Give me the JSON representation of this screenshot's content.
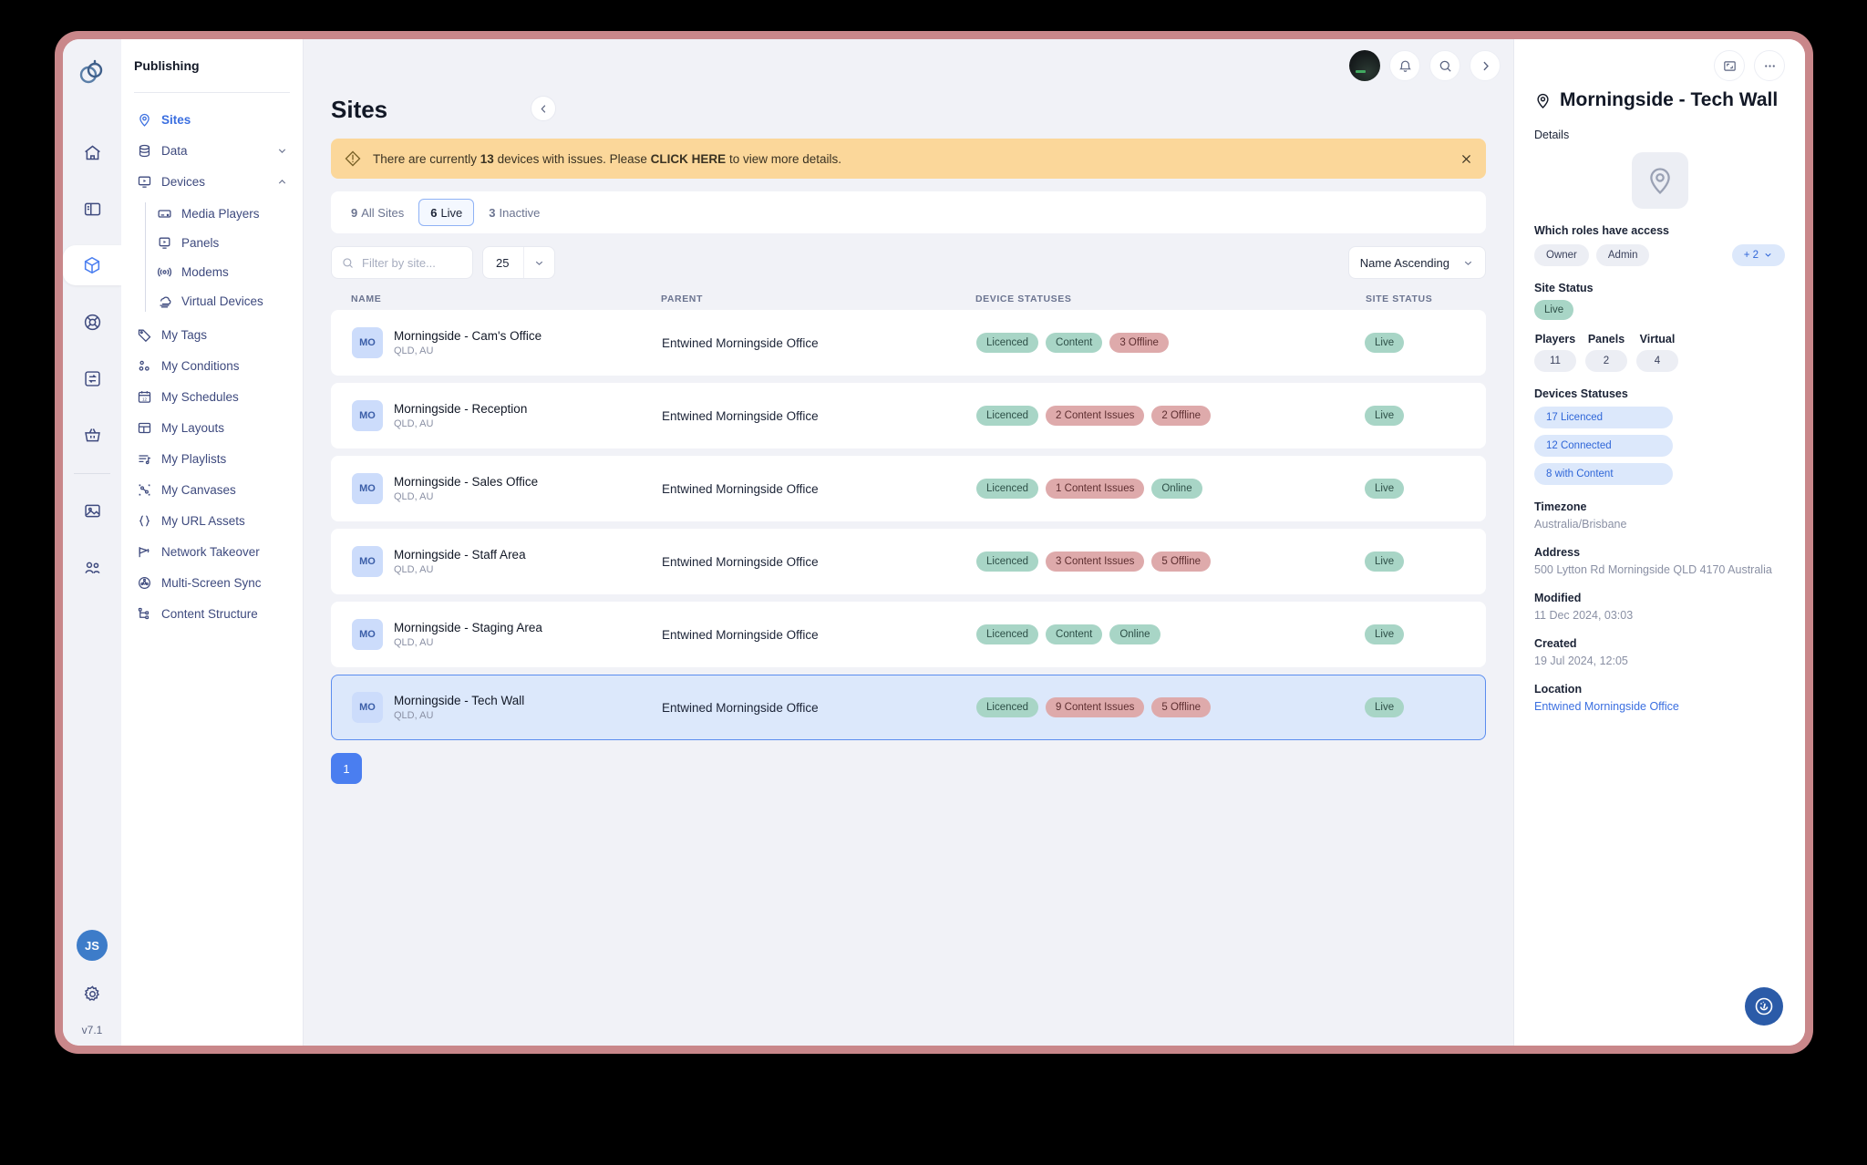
{
  "rail": {
    "logo_icon": "brand-logo-icon",
    "items": [
      {
        "name": "home",
        "icon": "home-icon",
        "active": false
      },
      {
        "name": "layouts",
        "icon": "panel-layout-icon",
        "active": false
      },
      {
        "name": "publishing",
        "icon": "package-cube-icon",
        "active": true
      },
      {
        "name": "support",
        "icon": "lifebuoy-icon",
        "active": false
      },
      {
        "name": "sync",
        "icon": "sync-exchange-icon",
        "active": false
      },
      {
        "name": "store",
        "icon": "basket-icon",
        "active": false
      },
      {
        "name": "media",
        "icon": "image-icon",
        "active": false
      },
      {
        "name": "users",
        "icon": "users-group-icon",
        "active": false
      }
    ],
    "user_initials": "JS",
    "settings_icon": "gear-icon",
    "version": "v7.1"
  },
  "nav": {
    "title": "Publishing",
    "items": [
      {
        "label": "Sites",
        "icon": "location-pin-icon",
        "active": true,
        "chevron": ""
      },
      {
        "label": "Data",
        "icon": "database-icon",
        "active": false,
        "chevron": "down"
      },
      {
        "label": "Devices",
        "icon": "device-screen-icon",
        "active": false,
        "chevron": "up"
      }
    ],
    "devices_children": [
      {
        "label": "Media Players",
        "icon": "media-player-icon"
      },
      {
        "label": "Panels",
        "icon": "panel-icon"
      },
      {
        "label": "Modems",
        "icon": "modem-signal-icon"
      },
      {
        "label": "Virtual Devices",
        "icon": "virtual-device-icon"
      }
    ],
    "items_after": [
      {
        "label": "My Tags",
        "icon": "tag-icon"
      },
      {
        "label": "My Conditions",
        "icon": "conditions-icon"
      },
      {
        "label": "My Schedules",
        "icon": "calendar-icon"
      },
      {
        "label": "My Layouts",
        "icon": "layout-grid-icon"
      },
      {
        "label": "My Playlists",
        "icon": "playlist-music-icon"
      },
      {
        "label": "My Canvases",
        "icon": "canvas-nodes-icon"
      },
      {
        "label": "My URL Assets",
        "icon": "curly-braces-icon"
      },
      {
        "label": "Network Takeover",
        "icon": "megaphone-icon"
      },
      {
        "label": "Multi-Screen Sync",
        "icon": "film-reel-icon"
      },
      {
        "label": "Content Structure",
        "icon": "tree-structure-icon"
      }
    ],
    "collapse_icon": "chevron-left-icon"
  },
  "topbar": {
    "avatar_icon": "user-avatar",
    "bell_icon": "bell-icon",
    "search_icon": "search-icon",
    "forward_icon": "chevron-right-icon",
    "expand_icon": "expand-panel-icon",
    "more_icon": "more-horizontal-icon"
  },
  "main": {
    "page_title": "Sites",
    "alert": {
      "icon": "warning-diamond-icon",
      "text_before": "There are currently ",
      "count": "13",
      "text_mid": " devices with issues. Please ",
      "link": "CLICK HERE",
      "text_after": " to view more details.",
      "close_icon": "close-icon"
    },
    "tabs": [
      {
        "count": "9",
        "label": "All Sites",
        "active": false
      },
      {
        "count": "6",
        "label": "Live",
        "active": true
      },
      {
        "count": "3",
        "label": "Inactive",
        "active": false
      }
    ],
    "search": {
      "placeholder": "Filter by site...",
      "value": "",
      "icon": "search-icon"
    },
    "page_size": {
      "value": "25",
      "caret_icon": "chevron-down-icon"
    },
    "sort": {
      "value": "Name Ascending",
      "caret_icon": "chevron-down-icon"
    },
    "columns": {
      "name": "NAME",
      "parent": "PARENT",
      "device_statuses": "DEVICE STATUSES",
      "site_status": "SITE STATUS"
    },
    "rows": [
      {
        "initials": "MO",
        "name": "Morningside - Cam's Office",
        "location": "QLD, AU",
        "parent": "Entwined Morningside Office",
        "statuses": [
          {
            "label": "Licenced",
            "tone": "green"
          },
          {
            "label": "Content",
            "tone": "green"
          },
          {
            "label": "3 Offline",
            "tone": "red"
          }
        ],
        "site_status": {
          "label": "Live",
          "tone": "green"
        },
        "selected": false
      },
      {
        "initials": "MO",
        "name": "Morningside - Reception",
        "location": "QLD, AU",
        "parent": "Entwined Morningside Office",
        "statuses": [
          {
            "label": "Licenced",
            "tone": "green"
          },
          {
            "label": "2 Content Issues",
            "tone": "red"
          },
          {
            "label": "2 Offline",
            "tone": "red"
          }
        ],
        "site_status": {
          "label": "Live",
          "tone": "green"
        },
        "selected": false
      },
      {
        "initials": "MO",
        "name": "Morningside - Sales Office",
        "location": "QLD, AU",
        "parent": "Entwined Morningside Office",
        "statuses": [
          {
            "label": "Licenced",
            "tone": "green"
          },
          {
            "label": "1 Content Issues",
            "tone": "red"
          },
          {
            "label": "Online",
            "tone": "green"
          }
        ],
        "site_status": {
          "label": "Live",
          "tone": "green"
        },
        "selected": false
      },
      {
        "initials": "MO",
        "name": "Morningside - Staff Area",
        "location": "QLD, AU",
        "parent": "Entwined Morningside Office",
        "statuses": [
          {
            "label": "Licenced",
            "tone": "green"
          },
          {
            "label": "3 Content Issues",
            "tone": "red"
          },
          {
            "label": "5 Offline",
            "tone": "red"
          }
        ],
        "site_status": {
          "label": "Live",
          "tone": "green"
        },
        "selected": false
      },
      {
        "initials": "MO",
        "name": "Morningside - Staging Area",
        "location": "QLD, AU",
        "parent": "Entwined Morningside Office",
        "statuses": [
          {
            "label": "Licenced",
            "tone": "green"
          },
          {
            "label": "Content",
            "tone": "green"
          },
          {
            "label": "Online",
            "tone": "green"
          }
        ],
        "site_status": {
          "label": "Live",
          "tone": "green"
        },
        "selected": false
      },
      {
        "initials": "MO",
        "name": "Morningside - Tech Wall",
        "location": "QLD, AU",
        "parent": "Entwined Morningside Office",
        "statuses": [
          {
            "label": "Licenced",
            "tone": "green"
          },
          {
            "label": "9 Content Issues",
            "tone": "red"
          },
          {
            "label": "5 Offline",
            "tone": "red"
          }
        ],
        "site_status": {
          "label": "Live",
          "tone": "green"
        },
        "selected": true
      }
    ],
    "pagination": {
      "current": "1"
    }
  },
  "detail": {
    "title": "Morningside - Tech Wall",
    "title_icon": "location-pin-icon",
    "details_label": "Details",
    "thumb_icon": "location-pin-icon",
    "roles_label": "Which roles have access",
    "roles": [
      "Owner",
      "Admin"
    ],
    "roles_more": "+ 2",
    "roles_more_icon": "chevron-down-icon",
    "site_status_label": "Site Status",
    "site_status": "Live",
    "counts": [
      {
        "label": "Players",
        "value": "11"
      },
      {
        "label": "Panels",
        "value": "2"
      },
      {
        "label": "Virtual",
        "value": "4"
      }
    ],
    "devices_statuses_label": "Devices Statuses",
    "devices_statuses": [
      "17 Licenced",
      "12 Connected",
      "8 with Content"
    ],
    "timezone_label": "Timezone",
    "timezone": "Australia/Brisbane",
    "address_label": "Address",
    "address": "500 Lytton Rd Morningside QLD 4170 Australia",
    "modified_label": "Modified",
    "modified": "11 Dec 2024, 03:03",
    "created_label": "Created",
    "created": "19 Jul 2024, 12:05",
    "location_label": "Location",
    "location": "Entwined Morningside Office",
    "fab_icon": "help-assistant-icon"
  },
  "colors": {
    "frame": "#c9878a",
    "accent": "#4a7ef0",
    "alert_bg": "#fbd79a",
    "green_pill": "#a8d5c6",
    "red_pill": "#deaaab",
    "selected_row": "#dce8fb"
  }
}
